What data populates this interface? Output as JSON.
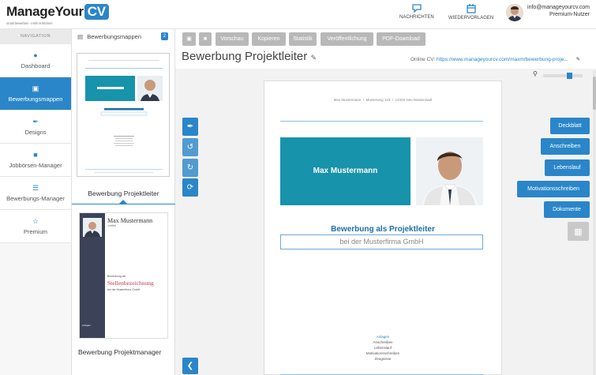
{
  "header": {
    "logo_text": "ManageYour",
    "logo_cv": "CV",
    "logo_tagline": "smart bewerben - mehr erreichen!",
    "nav": [
      {
        "label": "NACHRICHTEN",
        "icon": "chat-icon"
      },
      {
        "label": "WIEDERVORLAGEN",
        "icon": "calendar-icon"
      }
    ],
    "user_email": "info@manageyourcv.com",
    "user_role": "Premium-Nutzer"
  },
  "sidebar": {
    "heading": "NAVIGATION",
    "items": [
      {
        "label": "Dashboard",
        "icon": "user-icon",
        "active": false
      },
      {
        "label": "Bewerbungsmappen",
        "icon": "document-icon",
        "active": true
      },
      {
        "label": "Designs",
        "icon": "brush-icon",
        "active": false
      },
      {
        "label": "Jobbörsen-Manager",
        "icon": "briefcase-icon",
        "active": false
      },
      {
        "label": "Bewerbungs-Manager",
        "icon": "list-icon",
        "active": false
      },
      {
        "label": "Premium",
        "icon": "star-icon",
        "active": false
      }
    ]
  },
  "folders": {
    "heading": "Bewerbungsmappen",
    "count": "2",
    "items": [
      {
        "name": "Bewerbung Projektleiter"
      },
      {
        "name": "Bewerbung Projektmanager"
      }
    ],
    "thumb2": {
      "name_line": "Max Mustermann",
      "job_line": "Jobtitel",
      "position_small": "Bewerbung als",
      "position_big": "Stellenbezeichnung",
      "company": "bei der Musterfirma GmbH",
      "anlagen": "Anlagen"
    }
  },
  "toolbar": {
    "buttons": [
      "Vorschau",
      "Kopieren",
      "Statistik",
      "Veröffentlichung",
      "PDF-Download"
    ]
  },
  "page": {
    "title": "Bewerbung Projektleiter",
    "online_label": "Online CV:",
    "online_url": "https://www.manageyourcv.com/maxm/bewerbung-proje..."
  },
  "document": {
    "address_line": "Max Mustermann  /  Musterweg 123  /  12345 Neu Musterstadt",
    "name": "Max Mustermann",
    "heading": "Bewerbung als Projektleiter",
    "company": "bei der Musterfirma GmbH",
    "attachments_title": "Anlagen",
    "attachments": [
      "Anschreiben",
      "Lebenslauf",
      "Motivationsschreiben",
      "Zeugnisse"
    ]
  },
  "right_tabs": [
    "Deckblatt",
    "Anschreiben",
    "Lebenslauf",
    "Motivationsschreiben",
    "Dokumente"
  ],
  "colors": {
    "accent": "#2a86c8",
    "teal": "#1793ab",
    "heading_blue": "#1c6fa6"
  }
}
